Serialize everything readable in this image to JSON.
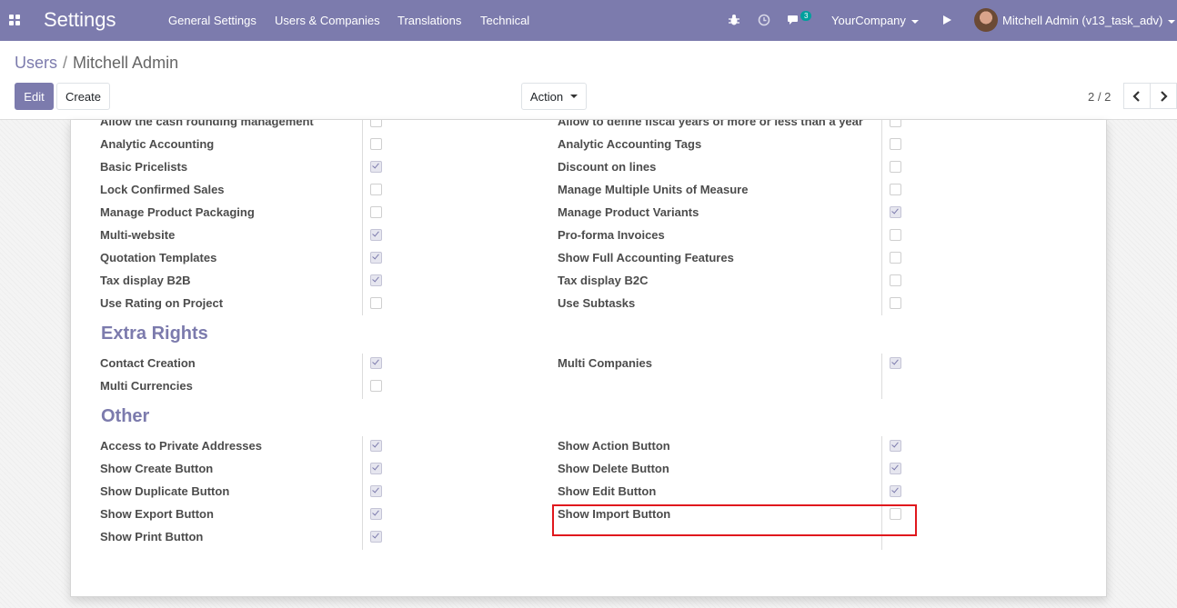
{
  "navbar": {
    "app_title": "Settings",
    "menu": [
      "General Settings",
      "Users & Companies",
      "Translations",
      "Technical"
    ],
    "icons": [
      "bug-icon",
      "clock-icon",
      "chat-icon",
      "play-icon"
    ],
    "message_count": "3",
    "company": "YourCompany",
    "user": "Mitchell Admin (v13_task_adv)"
  },
  "breadcrumb": {
    "parent": "Users",
    "current": "Mitchell Admin"
  },
  "buttons": {
    "edit": "Edit",
    "create": "Create",
    "action": "Action"
  },
  "pager": {
    "value": "2 / 2"
  },
  "rows": [
    {
      "left": "Allow the cash rounding management",
      "left_checked": false,
      "right": "Allow to define fiscal years of more or less than a year",
      "right_checked": false
    },
    {
      "left": "Analytic Accounting",
      "left_checked": false,
      "right": "Analytic Accounting Tags",
      "right_checked": false
    },
    {
      "left": "Basic Pricelists",
      "left_checked": true,
      "right": "Discount on lines",
      "right_checked": false
    },
    {
      "left": "Lock Confirmed Sales",
      "left_checked": false,
      "right": "Manage Multiple Units of Measure",
      "right_checked": false
    },
    {
      "left": "Manage Product Packaging",
      "left_checked": false,
      "right": "Manage Product Variants",
      "right_checked": true
    },
    {
      "left": "Multi-website",
      "left_checked": true,
      "right": "Pro-forma Invoices",
      "right_checked": false
    },
    {
      "left": "Quotation Templates",
      "left_checked": true,
      "right": "Show Full Accounting Features",
      "right_checked": false
    },
    {
      "left": "Tax display B2B",
      "left_checked": true,
      "right": "Tax display B2C",
      "right_checked": false
    },
    {
      "left": "Use Rating on Project",
      "left_checked": false,
      "right": "Use Subtasks",
      "right_checked": false
    }
  ],
  "extra_rights": {
    "title": "Extra Rights",
    "rows": [
      {
        "left": "Contact Creation",
        "left_checked": true,
        "right": "Multi Companies",
        "right_checked": true
      },
      {
        "left": "Multi Currencies",
        "left_checked": false
      }
    ]
  },
  "other": {
    "title": "Other",
    "rows": [
      {
        "left": "Access to Private Addresses",
        "left_checked": true,
        "right": "Show Action Button",
        "right_checked": true
      },
      {
        "left": "Show Create Button",
        "left_checked": true,
        "right": "Show Delete Button",
        "right_checked": true
      },
      {
        "left": "Show Duplicate Button",
        "left_checked": true,
        "right": "Show Edit Button",
        "right_checked": true
      },
      {
        "left": "Show Export Button",
        "left_checked": true,
        "right": "Show Import Button",
        "right_checked": false
      },
      {
        "left": "Show Print Button",
        "left_checked": true
      }
    ]
  },
  "colors": {
    "brand": "#7c7bad",
    "badge": "#00a09d",
    "highlight": "#e0181d"
  }
}
